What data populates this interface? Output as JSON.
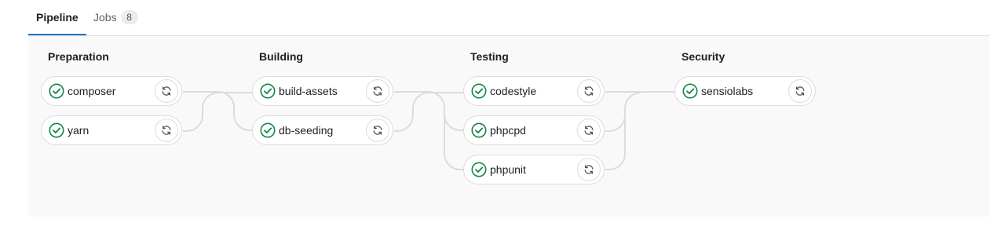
{
  "tabs": [
    {
      "label": "Pipeline",
      "active": true
    },
    {
      "label": "Jobs",
      "badge": "8",
      "active": false
    }
  ],
  "icons": {
    "status": "status-success-icon",
    "action": "retry-icon"
  },
  "colors": {
    "success": "#108548",
    "active_tab_underline": "#1f75cb"
  },
  "stages": [
    {
      "name": "Preparation",
      "jobs": [
        "composer",
        "yarn"
      ]
    },
    {
      "name": "Building",
      "jobs": [
        "build-assets",
        "db-seeding"
      ]
    },
    {
      "name": "Testing",
      "jobs": [
        "codestyle",
        "phpcpd",
        "phpunit"
      ]
    },
    {
      "name": "Security",
      "jobs": [
        "sensiolabs"
      ]
    }
  ]
}
